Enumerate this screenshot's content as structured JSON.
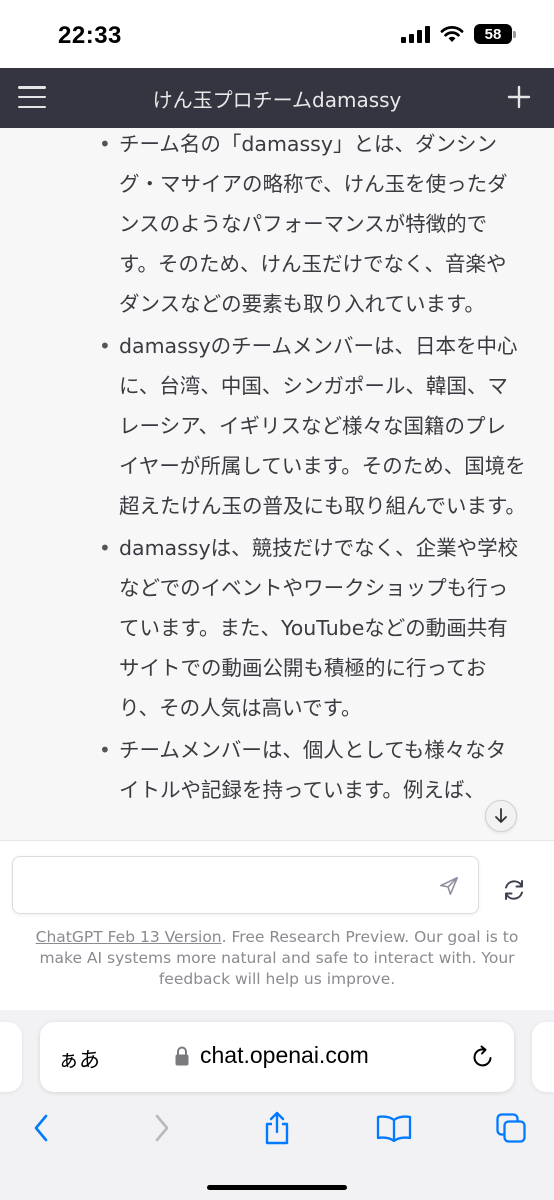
{
  "status": {
    "time": "22:33",
    "battery": "58"
  },
  "header": {
    "title": "けん玉プロチームdamassy"
  },
  "bullets": [
    "チーム名の「damassy」とは、ダンシング・マサイアの略称で、けん玉を使ったダンスのようなパフォーマンスが特徴的です。そのため、けん玉だけでなく、音楽やダンスなどの要素も取り入れています。",
    "damassyのチームメンバーは、日本を中心に、台湾、中国、シンガポール、韓国、マレーシア、イギリスなど様々な国籍のプレイヤーが所属しています。そのため、国境を超えたけん玉の普及にも取り組んでいます。",
    "damassyは、競技だけでなく、企業や学校などでのイベントやワークショップも行っています。また、YouTubeなどの動画共有サイトでの動画公開も積極的に行っており、その人気は高いです。",
    "チームメンバーは、個人としても様々なタイトルや記録を持っています。例えば、"
  ],
  "input": {
    "value": "",
    "placeholder": ""
  },
  "footer": {
    "link": "ChatGPT Feb 13 Version",
    "text": ". Free Research Preview. Our goal is to make AI systems more natural and safe to interact with. Your feedback will help us improve."
  },
  "safari": {
    "aa": "ぁあ",
    "url": "chat.openai.com"
  },
  "icons": {
    "menu": "hamburger-icon",
    "new_chat": "plus-icon",
    "send": "send-icon",
    "regenerate": "regenerate-icon",
    "scroll": "arrow-down-icon",
    "lock": "lock-icon",
    "reload": "reload-icon",
    "back": "chevron-left-icon",
    "forward": "chevron-right-icon",
    "share": "share-icon",
    "bookmarks": "book-icon",
    "tabs": "tabs-icon"
  },
  "colors": {
    "header_bg": "#343541",
    "safari_blue": "#007aff"
  }
}
